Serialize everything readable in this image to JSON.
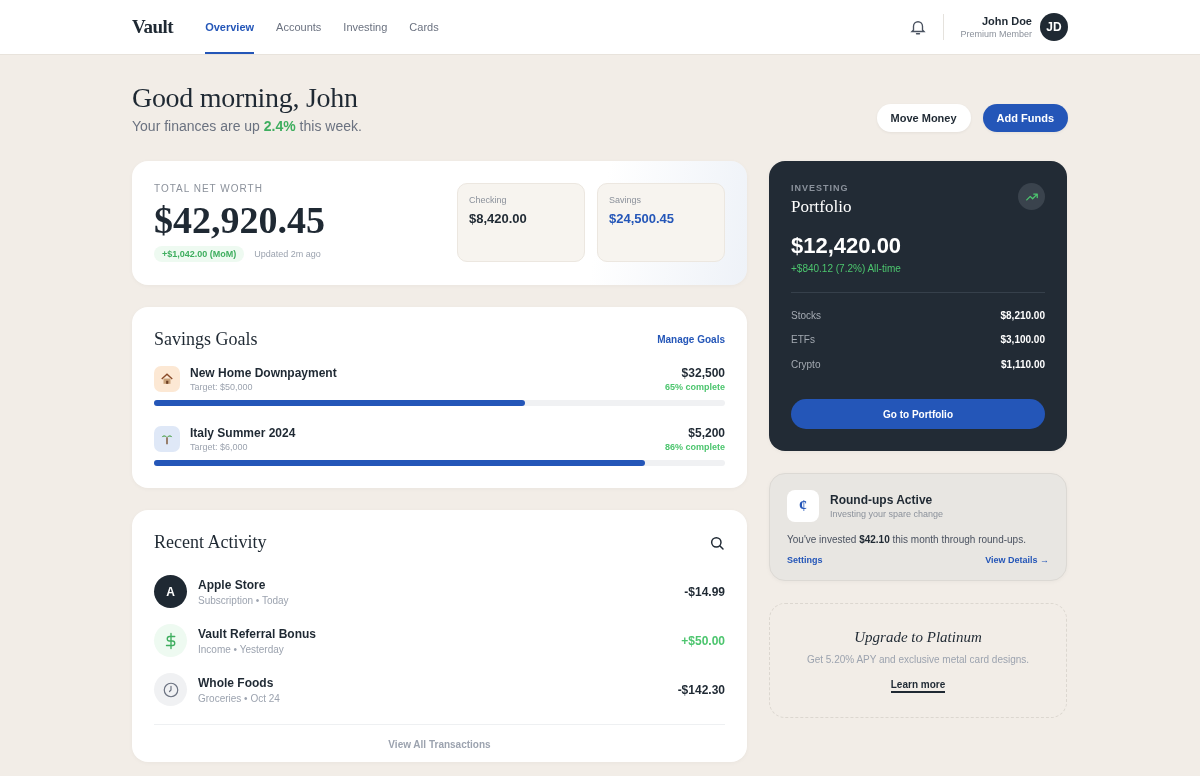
{
  "nav": {
    "logo": "Vault",
    "tabs": [
      {
        "label": "Overview",
        "selected": true
      },
      {
        "label": "Accounts",
        "selected": false
      },
      {
        "label": "Investing",
        "selected": false
      },
      {
        "label": "Cards",
        "selected": false
      }
    ],
    "user": {
      "name": "John Doe",
      "tier": "Premium Member",
      "initials": "JD"
    }
  },
  "greeting": {
    "title": "Good morning, John",
    "subtitle": "Your finances are up **2.4%** this week.",
    "buttons": [
      "Move Money",
      "Add Funds"
    ]
  },
  "net_worth": {
    "label": "TOTAL NET WORTH",
    "amount": "$42,920.45",
    "change": "+$1,042.00 (MoM)",
    "updated": "Updated 2m ago",
    "accounts": [
      {
        "name": "Checking",
        "amount": "$8,420.00",
        "color": "#1f2933"
      },
      {
        "name": "Savings",
        "amount": "$24,500.45",
        "color": "#2456b8"
      }
    ]
  },
  "savings_goals": {
    "title": "Savings Goals",
    "link": "Manage Goals",
    "goals": [
      {
        "kind": "house",
        "color": "#fce8d4",
        "name": "New Home Downpayment",
        "target": "Target: $50,000",
        "amount": "$32,500",
        "progress": "65% complete",
        "level": 0.65
      },
      {
        "kind": "palm",
        "color": "#dfe8f7",
        "name": "Italy Summer 2024",
        "target": "Target: $6,000",
        "amount": "$5,200",
        "progress": "86% complete",
        "level": 0.86
      }
    ]
  },
  "recent_activity": {
    "title": "Recent Activity",
    "transactions": [
      {
        "kind": "letter",
        "initial": "A",
        "name": "Apple Store",
        "meta": "Subscription • Today",
        "amount": "-$14.99",
        "credit": false
      },
      {
        "kind": "dollar",
        "name": "Vault Referral Bonus",
        "meta": "Income • Yesterday",
        "amount": "+$50.00",
        "credit": true
      },
      {
        "kind": "clock",
        "name": "Whole Foods",
        "meta": "Groceries • Oct 24",
        "amount": "-$142.30",
        "credit": false
      }
    ],
    "footer_link": "View All Transactions"
  },
  "portfolio": {
    "eyebrow": "INVESTING",
    "title": "Portfolio",
    "amount": "$12,420.00",
    "change": "+$840.12 (7.2%) All-time",
    "holdings": [
      {
        "name": "Stocks",
        "amount": "$8,210.00"
      },
      {
        "name": "ETFs",
        "amount": "$3,100.00"
      },
      {
        "name": "Crypto",
        "amount": "$1,110.00"
      }
    ],
    "button": "Go to Portfolio"
  },
  "roundups": {
    "icon_glyph": "¢",
    "title": "Round-ups Active",
    "subtitle": "Investing your spare change",
    "text": "You've invested **$42.10** this month through round-ups.",
    "settings": "Settings",
    "details": "View Details →"
  },
  "upgrade": {
    "title": "Upgrade to Platinum",
    "text": "Get 5.20% APY and exclusive metal card designs.",
    "link": "Learn more"
  }
}
